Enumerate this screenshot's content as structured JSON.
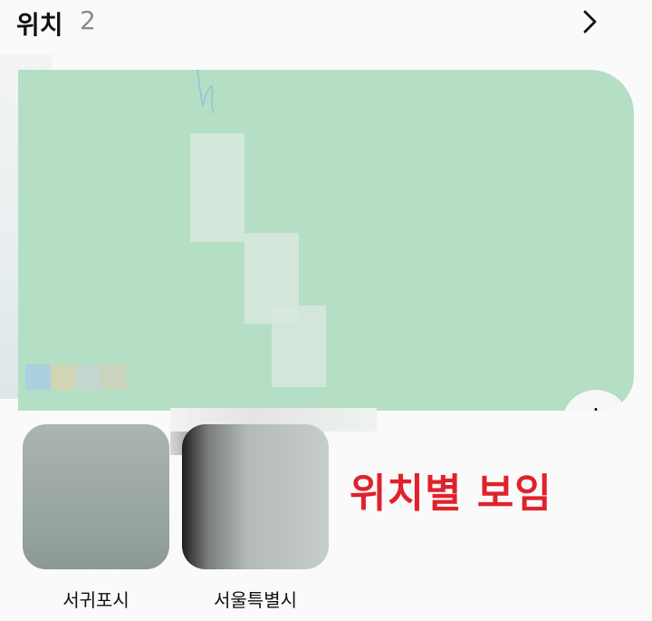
{
  "header": {
    "title": "위치",
    "count": "2",
    "more_icon": "chevron-right-icon"
  },
  "map": {
    "locate_icon": "locate-target-icon",
    "colors": {
      "land": "#b5dfc5"
    }
  },
  "albums": [
    {
      "label": "서귀포시"
    },
    {
      "label": "서울특별시"
    }
  ],
  "annotation": {
    "text": "위치별 보임",
    "color": "#e0222c"
  }
}
